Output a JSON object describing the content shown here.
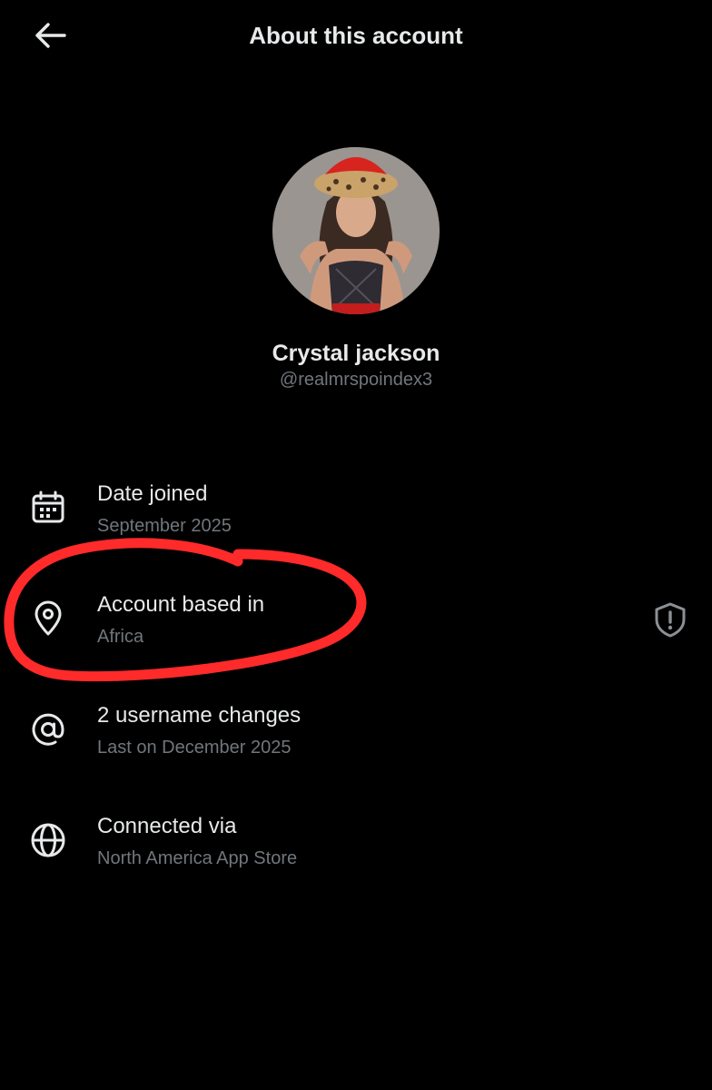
{
  "header": {
    "title": "About this account",
    "back_icon": "arrow-left-icon"
  },
  "profile": {
    "display_name": "Crystal jackson",
    "handle": "@realmrspoindex3"
  },
  "details": [
    {
      "icon": "calendar-icon",
      "label": "Date joined",
      "value": "September 2025"
    },
    {
      "icon": "location-pin-icon",
      "label": "Account based in",
      "value": "Africa",
      "badge_icon": "shield-alert-icon"
    },
    {
      "icon": "at-sign-icon",
      "label": "2 username changes",
      "value": "Last on December 2025"
    },
    {
      "icon": "globe-icon",
      "label": "Connected via",
      "value": "North America App Store"
    }
  ],
  "colors": {
    "background": "#000000",
    "primary_text": "#e7e9ea",
    "secondary_text": "#71767b",
    "annotation_red": "#ff2a2a"
  }
}
